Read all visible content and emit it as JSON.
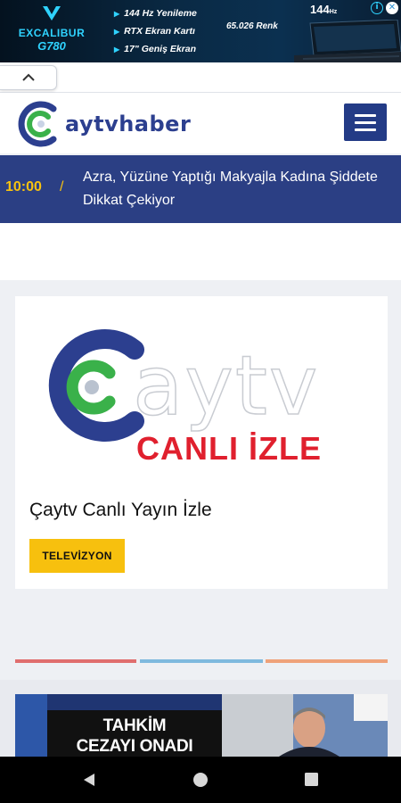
{
  "ad": {
    "brand_line1": "EXCALIBUR",
    "brand_line2": "G780",
    "features": [
      "144 Hz Yenileme",
      "RTX Ekran Kartı",
      "17\" Geniş Ekran"
    ],
    "color_count": "65.026 Renk",
    "hz_badge": "144",
    "hz_unit": "Hz",
    "close_icon": "✕",
    "info_icon": "i"
  },
  "header": {
    "logo_text": "aytvhaber"
  },
  "ticker": {
    "time": "10:00",
    "separator": "/",
    "headline": "Azra, Yüzüne Yaptığı Makyajla Kadına Şiddete Dikkat Çekiyor"
  },
  "post": {
    "image_logo_text": "aytv",
    "image_caption": "CANLI İZLE",
    "title": "Çaytv Canlı Yayın İzle",
    "category": "TELEVİZYON"
  },
  "next_post": {
    "image_headline_line1": "TAHKİM",
    "image_headline_line2": "CEZAYI ONADI"
  },
  "colors": {
    "brand_blue": "#2b3f84",
    "accent_yellow": "#f7c210",
    "logo_green": "#3ab14a",
    "caption_red": "#e0202e"
  }
}
